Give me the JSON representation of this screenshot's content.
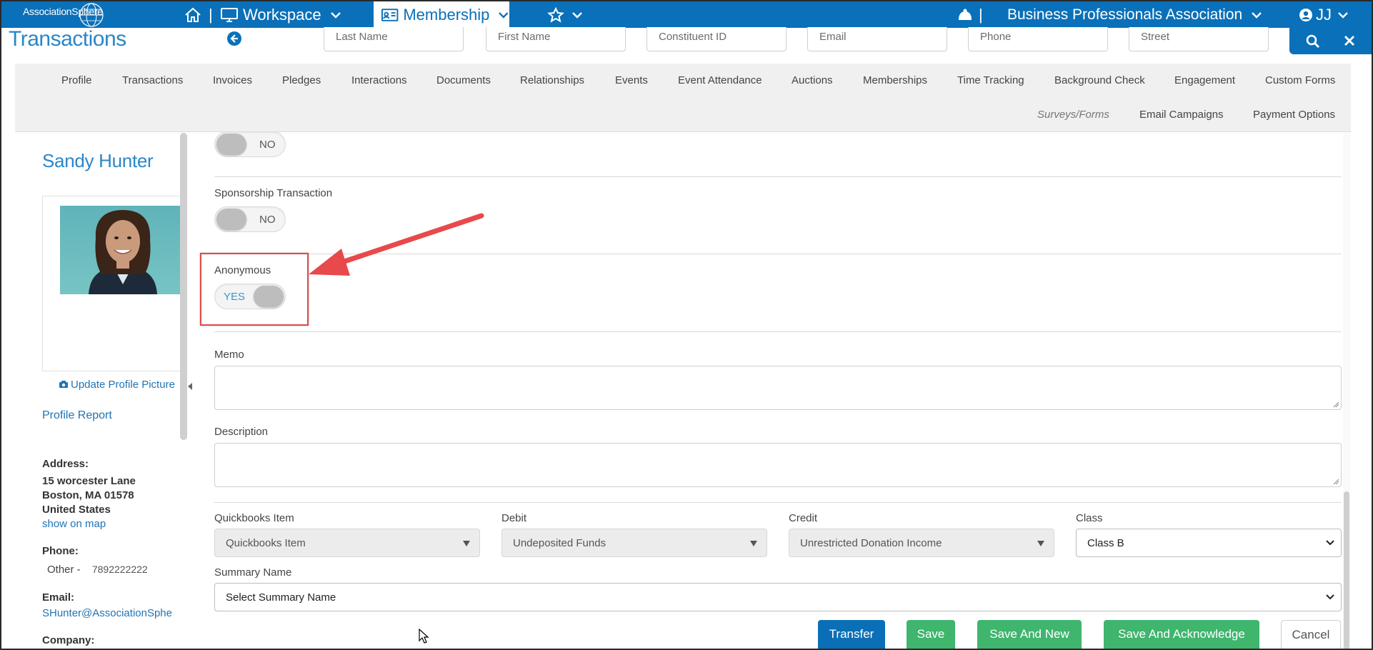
{
  "topnav": {
    "logo_text": "AssociationSphere",
    "workspace_label": "Workspace",
    "membership_label": "Membership",
    "org_name": "Business Professionals Association",
    "user_initials": "JJ",
    "separator": "|"
  },
  "header": {
    "title": "Transactions",
    "search": {
      "last_name_placeholder": "Last Name",
      "first_name_placeholder": "First Name",
      "constituent_id_placeholder": "Constituent ID",
      "email_placeholder": "Email",
      "phone_placeholder": "Phone",
      "street_placeholder": "Street"
    }
  },
  "tabs": {
    "row1": [
      "Profile",
      "Transactions",
      "Invoices",
      "Pledges",
      "Interactions",
      "Documents",
      "Relationships",
      "Events",
      "Event Attendance",
      "Auctions",
      "Memberships",
      "Time Tracking",
      "Background Check",
      "Engagement",
      "Custom Forms"
    ],
    "row2": [
      "Surveys/Forms",
      "Email Campaigns",
      "Payment Options"
    ]
  },
  "profile": {
    "name": "Sandy Hunter",
    "update_picture": "Update Profile Picture",
    "profile_report": "Profile Report",
    "address_label": "Address:",
    "address_line1": "15 worcester Lane",
    "address_line2": "Boston, MA 01578",
    "address_line3": "United States",
    "show_on_map": "show on map",
    "phone_label": "Phone:",
    "phone_type": "Other -",
    "phone_number": "7892222222",
    "email_label": "Email:",
    "email_value": "SHunter@AssociationSphe",
    "company_label": "Company:"
  },
  "form": {
    "toggle_top": {
      "state_text": "NO",
      "on": false
    },
    "sponsorship": {
      "label": "Sponsorship Transaction",
      "state_text": "NO",
      "on": false
    },
    "anonymous": {
      "label": "Anonymous",
      "state_text": "YES",
      "on": true
    },
    "memo_label": "Memo",
    "memo_value": "",
    "description_label": "Description",
    "description_value": "",
    "quickbooks_item": {
      "label": "Quickbooks Item",
      "value": "Quickbooks Item"
    },
    "debit": {
      "label": "Debit",
      "value": "Undeposited Funds"
    },
    "credit": {
      "label": "Credit",
      "value": "Unrestricted Donation Income"
    },
    "class": {
      "label": "Class",
      "value": "Class B"
    },
    "summary_name": {
      "label": "Summary Name",
      "value": "Select Summary Name"
    }
  },
  "actions": {
    "transfer": "Transfer",
    "save": "Save",
    "save_and_new": "Save And New",
    "save_and_acknowledge": "Save And Acknowledge",
    "cancel": "Cancel"
  },
  "colors": {
    "brand_blue": "#0a70b9",
    "link_blue": "#1f74b5",
    "save_green": "#3fb56e",
    "annotation_red": "#e04a4a"
  }
}
